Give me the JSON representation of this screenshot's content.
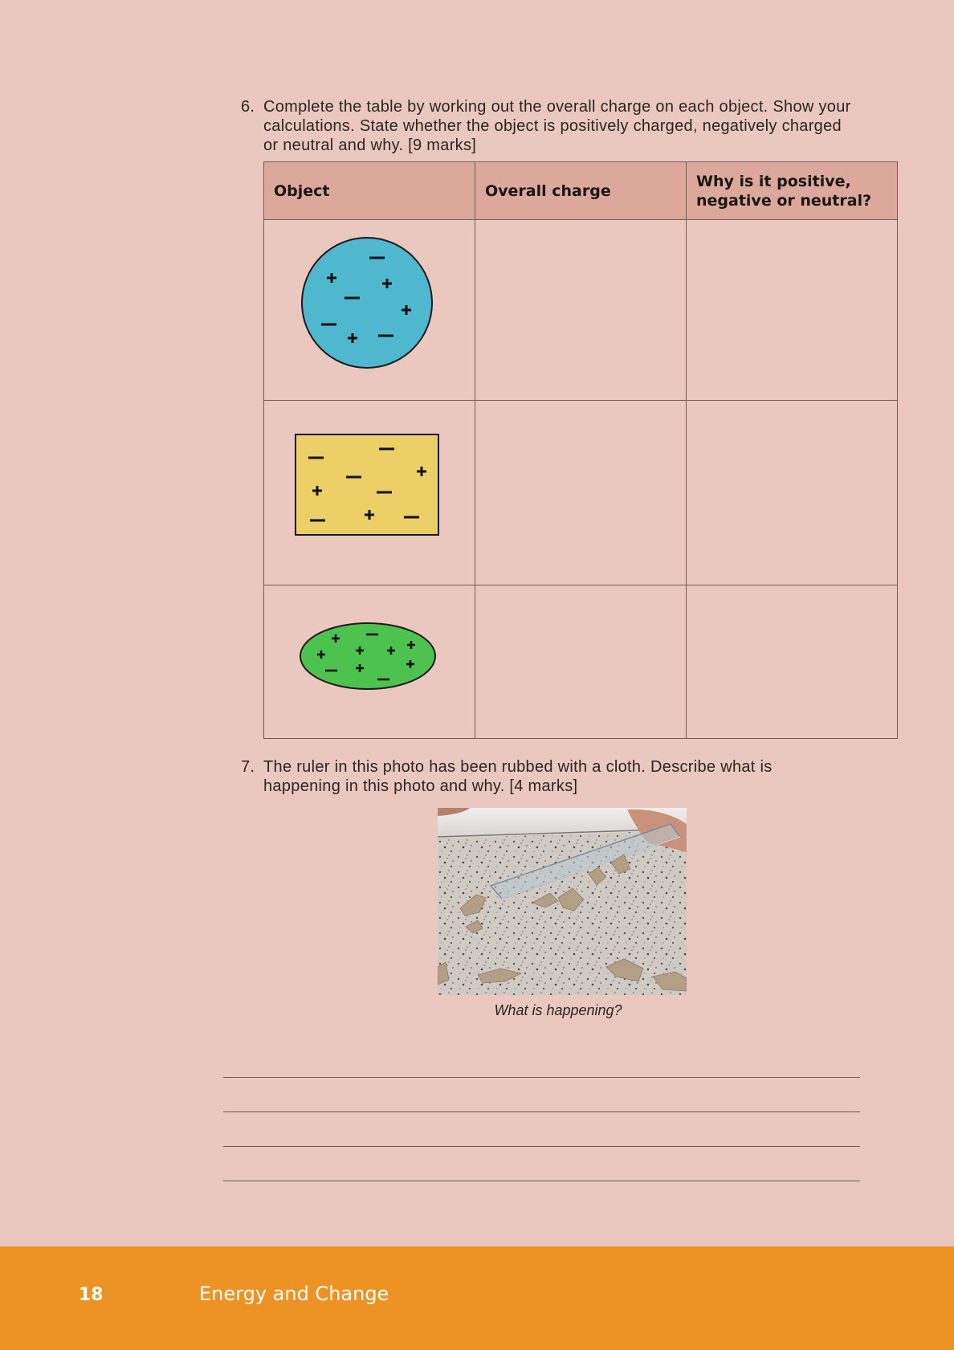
{
  "question6": {
    "number": "6.",
    "text": "Complete the table by working out the overall charge on each object. Show your calculations. State whether the object is positively charged, negatively charged or neutral and why. [9 marks]"
  },
  "table": {
    "headers": [
      "Object",
      "Overall charge",
      "Why is it positive, negative or neutral?"
    ],
    "rows": [
      {
        "shape": "circle",
        "color": "#4fb8cf",
        "charges": {
          "positive": 4,
          "negative": 4
        },
        "overall_charge": "",
        "reason": ""
      },
      {
        "shape": "rectangle",
        "color": "#ecd067",
        "charges": {
          "positive": 3,
          "negative": 6
        },
        "overall_charge": "",
        "reason": ""
      },
      {
        "shape": "ellipse",
        "color": "#4ec24f",
        "charges": {
          "positive": 7,
          "negative": 3
        },
        "overall_charge": "",
        "reason": ""
      }
    ]
  },
  "question7": {
    "number": "7.",
    "text": "The ruler in this photo has been rubbed with a cloth. Describe what is happening in this photo and why. [4 marks]"
  },
  "photo": {
    "caption": "What is happening?"
  },
  "answer_lines": 4,
  "footer": {
    "page_number": "18",
    "title": "Energy and Change"
  },
  "colors": {
    "background": "#eac8bf",
    "header_fill": "#dba89b",
    "footer_band": "#ed9325"
  }
}
